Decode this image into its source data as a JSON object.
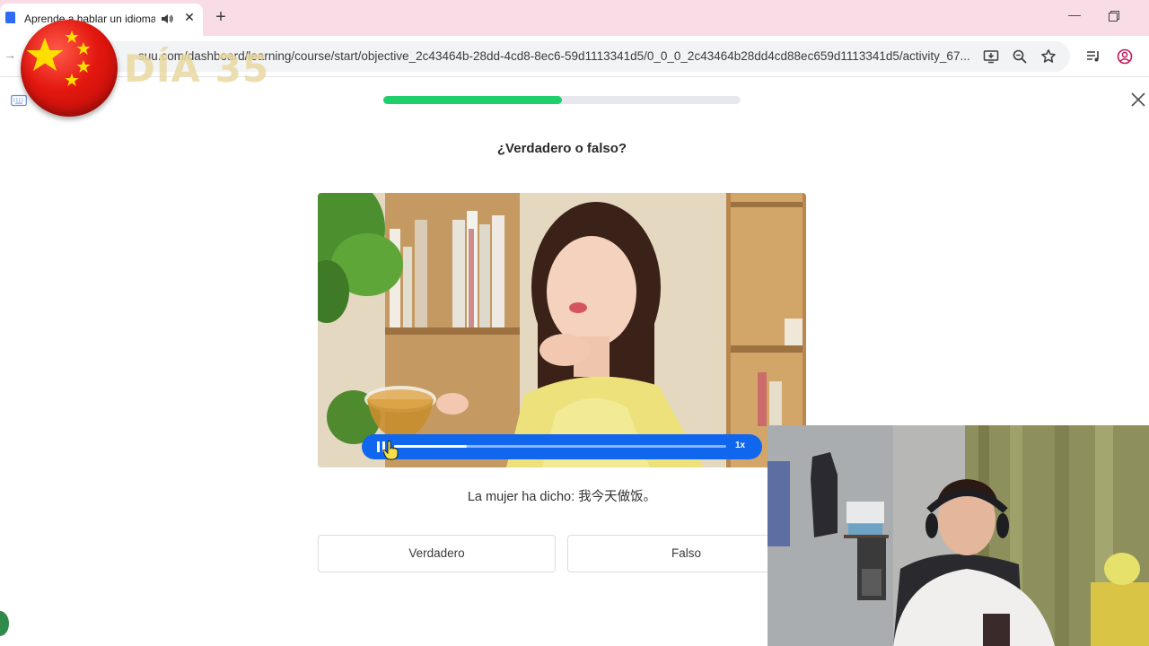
{
  "browser": {
    "tab_title": "Aprende a hablar un idioma",
    "url": "suu.com/dashboard/learning/course/start/objective_2c43464b-28dd-4cd8-8ec6-59d1113341d5/0_0_0_2c43464b28dd4cd88ec659d1113341d5/activity_67..."
  },
  "overlay": {
    "day_label": "DÍA 35"
  },
  "lesson": {
    "progress_percent": 50,
    "question": "¿Verdadero o falso?",
    "statement": "La mujer ha dicho: 我今天做饭。",
    "answers": [
      "Verdadero",
      "Falso"
    ],
    "audio": {
      "played_fraction": 0.22,
      "speed_label": "1x"
    }
  },
  "colors": {
    "tabbar": "#f9dde6",
    "progress": "#1fcf6b",
    "player": "#1166ee"
  }
}
